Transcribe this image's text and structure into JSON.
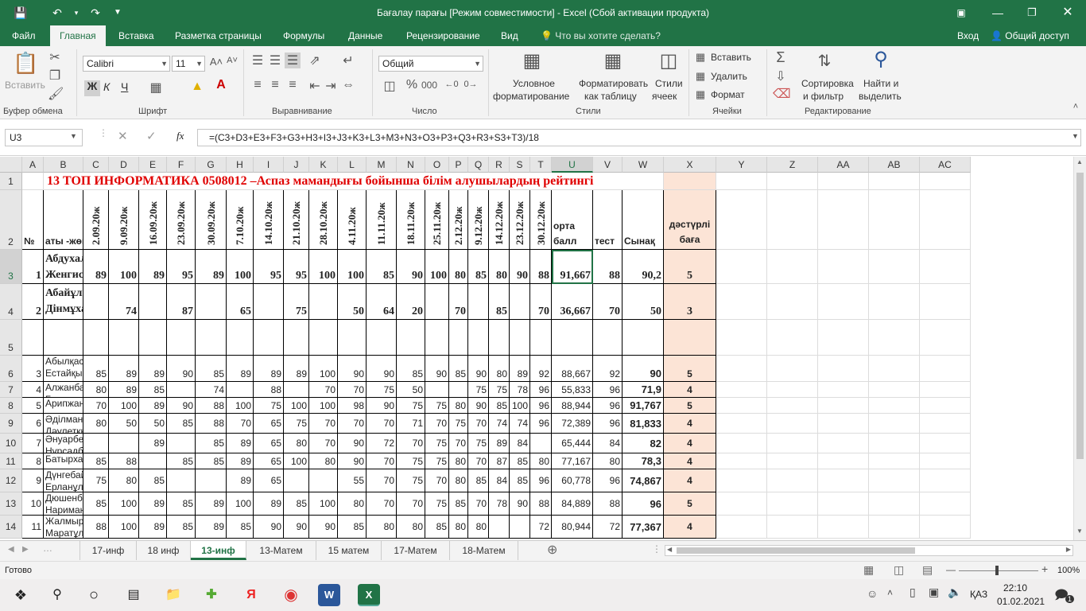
{
  "app": {
    "title": "Бағалау парағы  [Режим совместимости] - Excel (Сбой активации продукта)"
  },
  "tabs": [
    "Файл",
    "Главная",
    "Вставка",
    "Разметка страницы",
    "Формулы",
    "Данные",
    "Рецензирование",
    "Вид"
  ],
  "tell_me": "Что вы хотите сделать?",
  "login": "Вход",
  "share": "Общий доступ",
  "ribbon": {
    "paste": "Вставить",
    "clipboard": "Буфер обмена",
    "font_name": "Calibri",
    "font_size": "11",
    "font_group": "Шрифт",
    "bold": "Ж",
    "italic": "К",
    "underline": "Ч",
    "align_group": "Выравнивание",
    "number_format": "Общий",
    "number_group": "Число",
    "cond_format_1": "Условное",
    "cond_format_2": "форматирование",
    "format_table_1": "Форматировать",
    "format_table_2": "как таблицу",
    "cell_styles_1": "Стили",
    "cell_styles_2": "ячеек",
    "styles_group": "Стили",
    "insert": "Вставить",
    "delete": "Удалить",
    "format": "Формат",
    "cells_group": "Ячейки",
    "sort_1": "Сортировка",
    "sort_2": "и фильтр",
    "find_1": "Найти и",
    "find_2": "выделить",
    "editing_group": "Редактирование"
  },
  "namebox": "U3",
  "formula": "=(C3+D3+E3+F3+G3+H3+I3+J3+K3+L3+M3+N3+O3+P3+Q3+R3+S3+T3)/18",
  "columns": [
    "A",
    "B",
    "C",
    "D",
    "E",
    "F",
    "G",
    "H",
    "I",
    "J",
    "K",
    "L",
    "M",
    "N",
    "O",
    "P",
    "Q",
    "R",
    "S",
    "T",
    "U",
    "V",
    "W",
    "X",
    "Y",
    "Z",
    "AA",
    "AB",
    "AC"
  ],
  "rows": [
    "1",
    "2",
    "3",
    "4",
    "5",
    "6",
    "7",
    "8",
    "9",
    "10",
    "11",
    "12",
    "13",
    "14"
  ],
  "sheet": {
    "title": "13 ТОП        ИНФОРМАТИКА  0508012 –Аспаз мамандығы бойынша білім алушылардың рейтингі",
    "h_no": "№",
    "h_name": "аты -жөні",
    "dates": [
      "2.09.20ж",
      "9.09.20ж",
      "16.09.20ж",
      "23.09.20ж",
      "30.09.20ж",
      "7.10.20ж",
      "14.10.20ж",
      "21.10.20ж",
      "28.10.20ж",
      "4.11.20ж",
      "11.11.20ж",
      "18.11.20ж",
      "25.11.20ж",
      "2.12.20ж",
      "9.12.20ж",
      "14.12.20ж",
      "23.12.20ж",
      "30.12.20ж"
    ],
    "h_avg1": "орта",
    "h_avg2": "балл",
    "h_test": "тест",
    "h_exam": "Сынақ",
    "h_grade1": "дәстүрлі",
    "h_grade2": "баға",
    "students": [
      {
        "n": "1",
        "name1": "Абдухаликова Диана",
        "name2": "Женгисбайқызы",
        "scores": [
          "89",
          "100",
          "89",
          "95",
          "89",
          "100",
          "95",
          "95",
          "100",
          "100",
          "85",
          "90",
          "100",
          "80",
          "85",
          "80",
          "90",
          "88"
        ],
        "avg": "91,667",
        "test": "88",
        "exam": "90,2",
        "grade": "5"
      },
      {
        "n": "2",
        "name1": "Абайұлы",
        "name2": "Дінмұхаммед",
        "scores": [
          "",
          "74",
          "",
          "87",
          "",
          "65",
          "",
          "75",
          "",
          "50",
          "64",
          "20",
          "",
          "70",
          "",
          "85",
          "",
          "70"
        ],
        "avg": "36,667",
        "test": "70",
        "exam": "50",
        "grade": "3"
      },
      {
        "n": "",
        "name1": "",
        "name2": "",
        "scores": [
          "",
          "",
          "",
          "",
          "",
          "",
          "",
          "",
          "",
          "",
          "",
          "",
          "",
          "",
          "",
          "",
          "",
          ""
        ],
        "avg": "",
        "test": "",
        "exam": "",
        "grade": ""
      },
      {
        "n": "3",
        "name1": "Абылқасымова Назым",
        "name2": "Естайқызы",
        "scores": [
          "85",
          "89",
          "89",
          "90",
          "85",
          "89",
          "89",
          "89",
          "100",
          "90",
          "90",
          "85",
          "90",
          "85",
          "90",
          "80",
          "89",
          "92"
        ],
        "avg": "88,667",
        "test": "92",
        "exam": "90",
        "grade": "5"
      },
      {
        "n": "4",
        "name1": "Алжанбай Мейрамбек",
        "name2": "Бекжанұлы",
        "scores": [
          "80",
          "89",
          "85",
          "",
          "74",
          "",
          "88",
          "",
          "70",
          "70",
          "75",
          "50",
          "",
          "",
          "75",
          "75",
          "78",
          "96"
        ],
        "avg": "55,833",
        "test": "96",
        "exam": "71,9",
        "grade": "4"
      },
      {
        "n": "5",
        "name1": "Арипжан Аяулы",
        "name2": "",
        "scores": [
          "70",
          "100",
          "89",
          "90",
          "88",
          "100",
          "75",
          "100",
          "100",
          "98",
          "90",
          "75",
          "75",
          "80",
          "90",
          "85",
          "100",
          "96"
        ],
        "avg": "88,944",
        "test": "96",
        "exam": "91,767",
        "grade": "5"
      },
      {
        "n": "6",
        "name1": "Әділманап Айсұлу",
        "name2": "Дәулетқызы",
        "scores": [
          "80",
          "50",
          "50",
          "85",
          "88",
          "70",
          "65",
          "75",
          "70",
          "70",
          "70",
          "71",
          "70",
          "75",
          "70",
          "74",
          "74",
          "96"
        ],
        "avg": "72,389",
        "test": "96",
        "exam": "81,833",
        "grade": "4"
      },
      {
        "n": "7",
        "name1": "Әнуарбек Нұршат",
        "name2": "Нұрсадбекұлы",
        "scores": [
          "",
          "",
          "89",
          "",
          "85",
          "89",
          "65",
          "80",
          "70",
          "90",
          "72",
          "70",
          "75",
          "70",
          "75",
          "89",
          "84",
          ""
        ],
        "avg": "65,444",
        "test": "84",
        "exam": "82",
        "grade": "4"
      },
      {
        "n": "8",
        "name1": "Батырханұлы  Ғазиз",
        "name2": "",
        "scores": [
          "85",
          "88",
          "",
          "85",
          "85",
          "89",
          "65",
          "100",
          "80",
          "90",
          "70",
          "75",
          "75",
          "80",
          "70",
          "87",
          "85",
          "80"
        ],
        "avg": "77,167",
        "test": "80",
        "exam": "78,3",
        "grade": "4"
      },
      {
        "n": "9",
        "name1": "Дүнгебай Дидар",
        "name2": "Ерланұлы",
        "scores": [
          "75",
          "80",
          "85",
          "",
          "",
          "89",
          "65",
          "",
          "",
          "55",
          "70",
          "75",
          "70",
          "80",
          "85",
          "84",
          "85",
          "96"
        ],
        "avg": "60,778",
        "test": "96",
        "exam": "74,867",
        "grade": "4"
      },
      {
        "n": "10",
        "name1": "Дюшенбек Анеля",
        "name2": "Нариманқызы",
        "scores": [
          "85",
          "100",
          "89",
          "85",
          "89",
          "100",
          "89",
          "85",
          "100",
          "80",
          "70",
          "70",
          "75",
          "85",
          "70",
          "78",
          "90",
          "88"
        ],
        "avg": "84,889",
        "test": "88",
        "exam": "96",
        "grade": "5"
      },
      {
        "n": "11",
        "name1": "Жалмырзаев Рауан",
        "name2": "Маратұлы",
        "scores": [
          "88",
          "100",
          "89",
          "85",
          "89",
          "85",
          "90",
          "90",
          "90",
          "85",
          "80",
          "80",
          "85",
          "80",
          "80",
          "",
          "",
          "72"
        ],
        "avg": "80,944",
        "test": "72",
        "exam": "77,367",
        "grade": "4"
      }
    ]
  },
  "sheet_tabs": [
    "17-инф",
    "18 инф",
    "13-инф",
    "13-Матем",
    "15 матем",
    "17-Матем",
    "18-Матем"
  ],
  "status": {
    "ready": "Готово",
    "zoom": "100%"
  },
  "taskbar": {
    "lang": "ҚАЗ",
    "time": "22:10",
    "date": "01.02.2021",
    "notif": "1"
  }
}
